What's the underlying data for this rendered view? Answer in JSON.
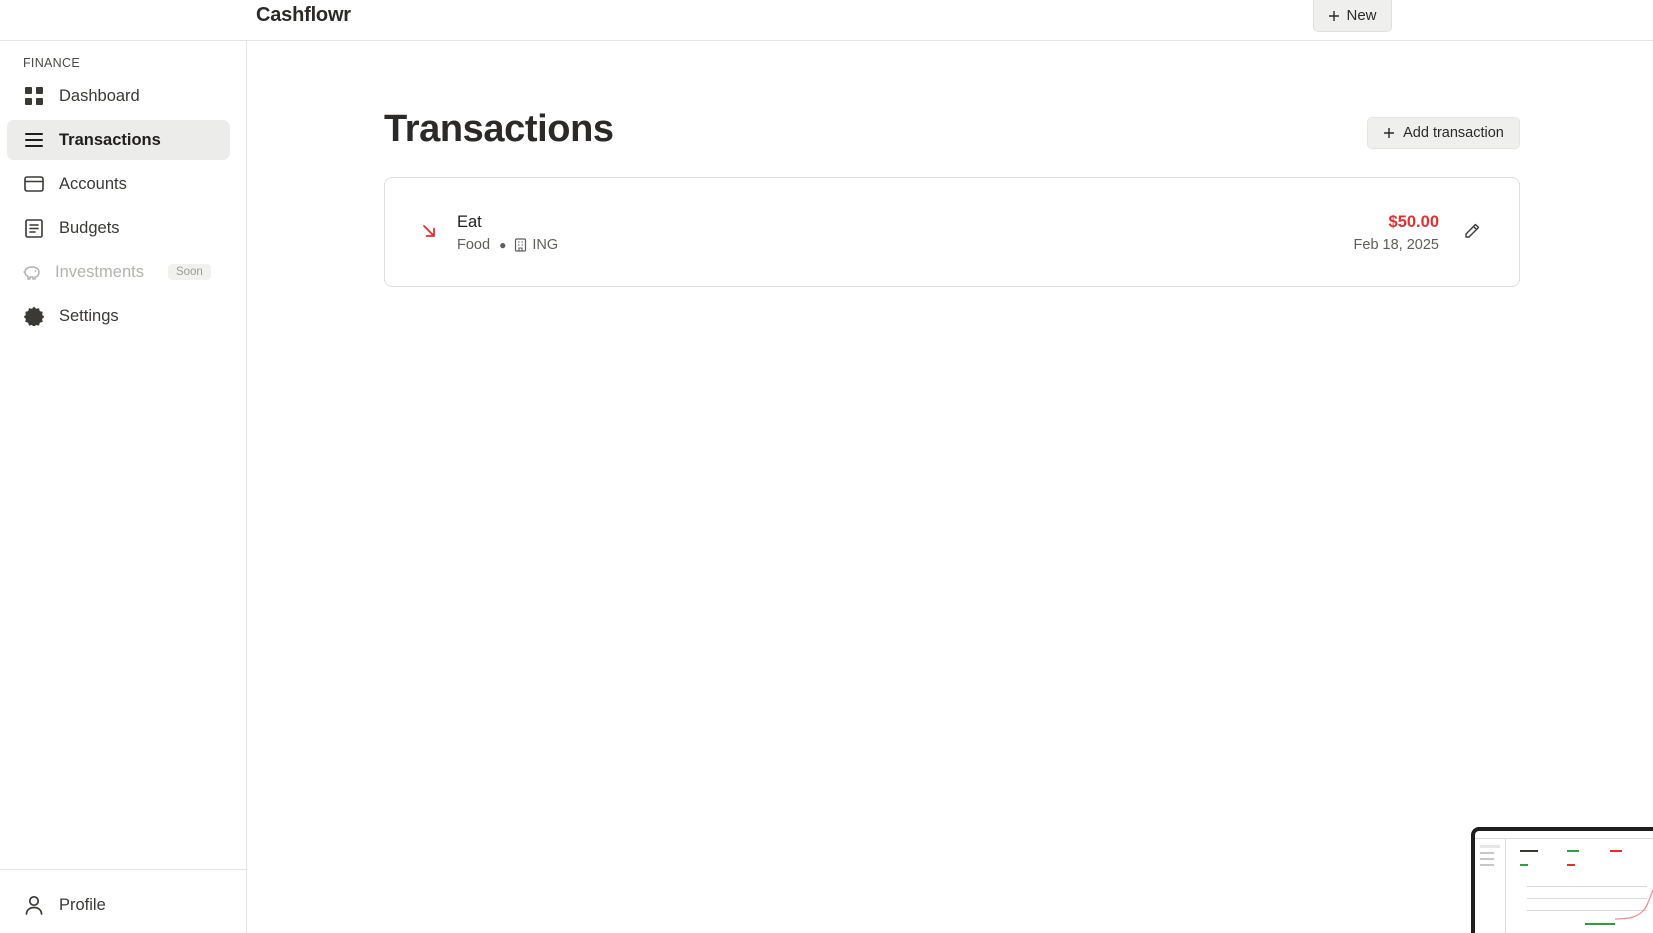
{
  "app": {
    "brand": "Cashflowr",
    "new_button_label": "New"
  },
  "sidebar": {
    "section_label": "FINANCE",
    "items": [
      {
        "label": "Dashboard",
        "icon": "dashboard-grid-icon",
        "active": false
      },
      {
        "label": "Transactions",
        "icon": "list-lines-icon",
        "active": true
      },
      {
        "label": "Accounts",
        "icon": "credit-card-icon",
        "active": false
      },
      {
        "label": "Budgets",
        "icon": "document-list-icon",
        "active": false
      },
      {
        "label": "Investments",
        "icon": "piggy-bank-icon",
        "active": false,
        "disabled": true,
        "badge": "Soon"
      },
      {
        "label": "Settings",
        "icon": "gear-icon",
        "active": false
      }
    ],
    "footer": {
      "label": "Profile",
      "icon": "user-icon"
    }
  },
  "main": {
    "title": "Transactions",
    "add_button_label": "Add transaction",
    "transactions": [
      {
        "title": "Eat",
        "category": "Food",
        "account": "ING",
        "amount": "$50.00",
        "date": "Feb 18, 2025",
        "direction": "outgoing"
      }
    ]
  },
  "colors": {
    "expense": "#e03131",
    "active_nav_bg": "#ececeb",
    "button_bg": "#efefee",
    "border": "#e4e4e2"
  }
}
